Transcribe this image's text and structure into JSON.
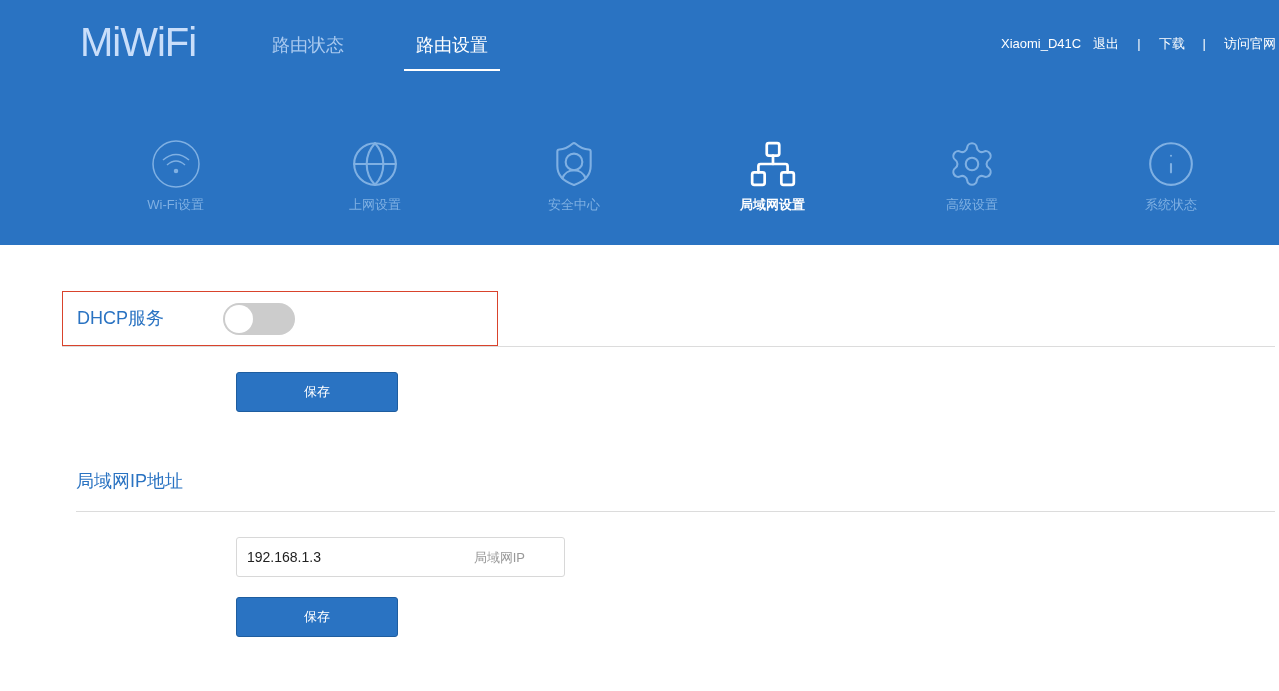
{
  "header": {
    "logo": "MiWiFi",
    "nav_tabs": [
      {
        "label": "路由状态",
        "selected": false
      },
      {
        "label": "路由设置",
        "selected": true
      }
    ],
    "user_links": [
      {
        "kind": "text",
        "label": "Xiaomi_D41C"
      },
      {
        "kind": "link",
        "label": "退出"
      },
      {
        "kind": "separator",
        "label": "|"
      },
      {
        "kind": "link",
        "label": "下载"
      },
      {
        "kind": "separator",
        "label": "|"
      },
      {
        "kind": "link",
        "label": "访问官网"
      }
    ]
  },
  "settings_menu": [
    {
      "kind": "wifi",
      "label": "Wi-Fi设置",
      "selected": false
    },
    {
      "kind": "globe",
      "label": "上网设置",
      "selected": false
    },
    {
      "kind": "shield",
      "label": "安全中心",
      "selected": false
    },
    {
      "kind": "network",
      "label": "局域网设置",
      "selected": true
    },
    {
      "kind": "gear",
      "label": "高级设置",
      "selected": false
    },
    {
      "kind": "info",
      "label": "系统状态",
      "selected": false
    }
  ],
  "dhcp_section": {
    "title": "DHCP服务",
    "highlighted": true,
    "on": false,
    "save_button": "保存"
  },
  "lan_ip_section": {
    "title": "局域网IP地址",
    "field": {
      "value": "192.168.1.3",
      "label": "局域网IP"
    },
    "save_button": "保存"
  }
}
